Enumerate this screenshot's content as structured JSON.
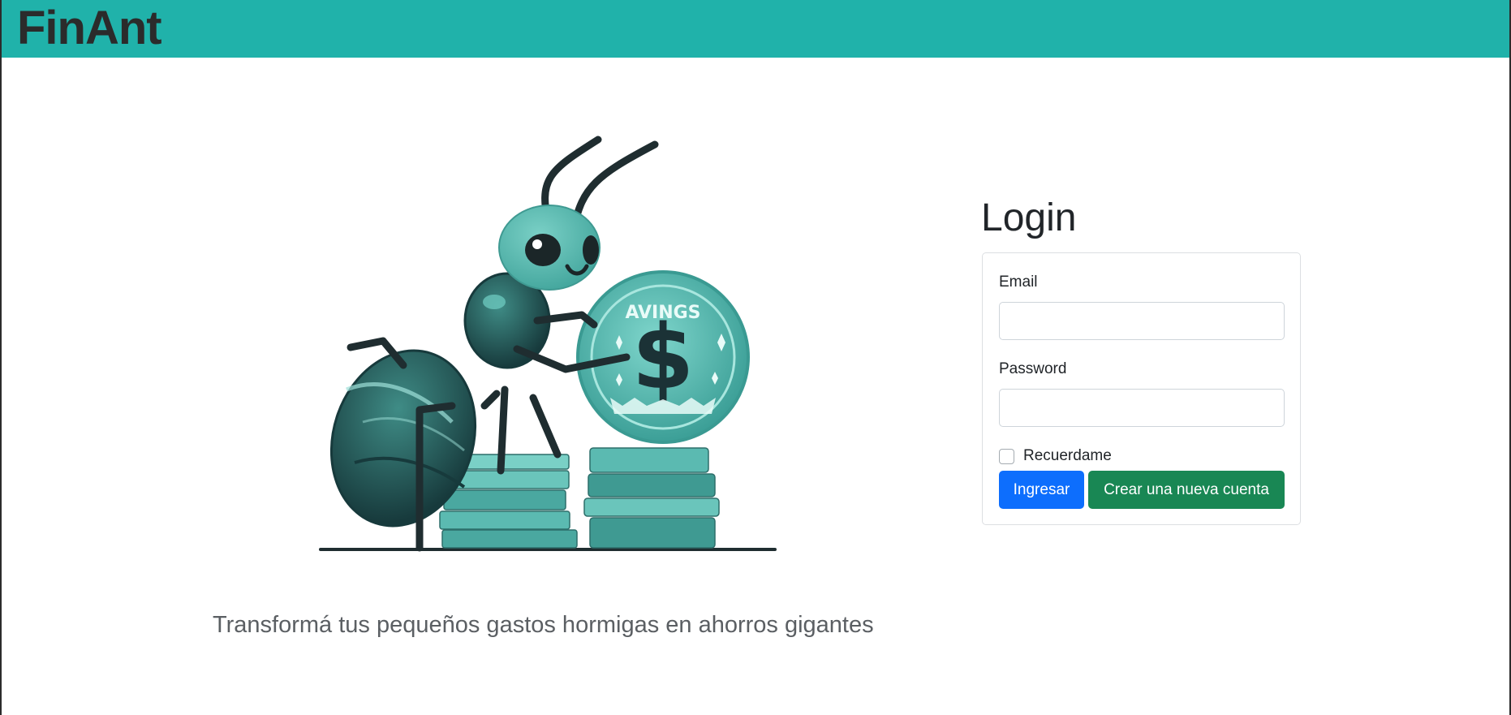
{
  "header": {
    "brand": "FinAnt",
    "accent_color": "#20b2aa"
  },
  "hero": {
    "illustration_icon": "ant-with-coins-illustration",
    "coin_text": "AVINGS",
    "coin_symbol": "$",
    "tagline": "Transformá tus pequeños gastos hormigas en ahorros gigantes"
  },
  "login": {
    "title": "Login",
    "email_label": "Email",
    "email_value": "",
    "password_label": "Password",
    "password_value": "",
    "remember_label": "Recuerdame",
    "remember_checked": false,
    "submit_label": "Ingresar",
    "submit_color": "#0d6efd",
    "register_label": "Crear una nueva cuenta",
    "register_color": "#198754"
  }
}
